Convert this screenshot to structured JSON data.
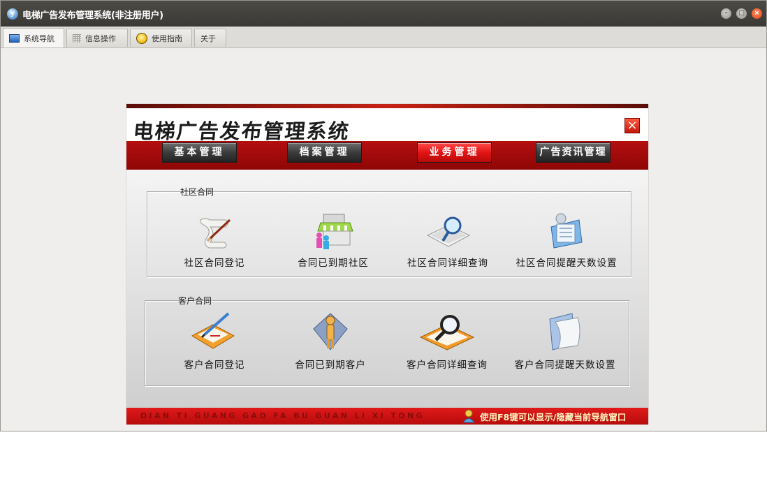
{
  "window": {
    "title": "电梯广告发布管理系统(非注册用户)"
  },
  "tabs": [
    {
      "label": "系统导航",
      "icon": "monitor-icon",
      "active": true
    },
    {
      "label": "信息操作",
      "icon": "grid-icon",
      "active": false
    },
    {
      "label": "使用指南",
      "icon": "bulb-icon",
      "active": false
    },
    {
      "label": "关于",
      "icon": "",
      "active": false
    }
  ],
  "panel": {
    "title": "电梯广告发布管理系统",
    "close_label": "×",
    "nav": [
      {
        "label": "基本管理",
        "active": false
      },
      {
        "label": "档案管理",
        "active": false
      },
      {
        "label": "业务管理",
        "active": true
      },
      {
        "label": "广告资讯管理",
        "active": false
      }
    ],
    "groups": [
      {
        "label": "社区合同",
        "items": [
          {
            "label": "社区合同登记",
            "icon": "scroll-pen-icon"
          },
          {
            "label": "合同已到期社区",
            "icon": "storefront-people-icon"
          },
          {
            "label": "社区合同详细查询",
            "icon": "magnifier-document-icon"
          },
          {
            "label": "社区合同提醒天数设置",
            "icon": "clipboard-settings-icon"
          }
        ]
      },
      {
        "label": "客户合同",
        "items": [
          {
            "label": "客户合同登记",
            "icon": "pencil-document-icon"
          },
          {
            "label": "合同已到期客户",
            "icon": "person-icon"
          },
          {
            "label": "客户合同详细查询",
            "icon": "magnifier-book-icon"
          },
          {
            "label": "客户合同提醒天数设置",
            "icon": "paper-curl-icon"
          }
        ]
      }
    ],
    "footer": {
      "pinyin": "DIAN TI GUANG GAO FA BU GUAN LI XI TONG",
      "tip": "使用F8键可以显示/隐藏当前导航窗口"
    }
  },
  "colors": {
    "accent_red": "#c41010",
    "nav_dark": "#3b3b3b",
    "tip_yellow": "#fff4c0"
  }
}
